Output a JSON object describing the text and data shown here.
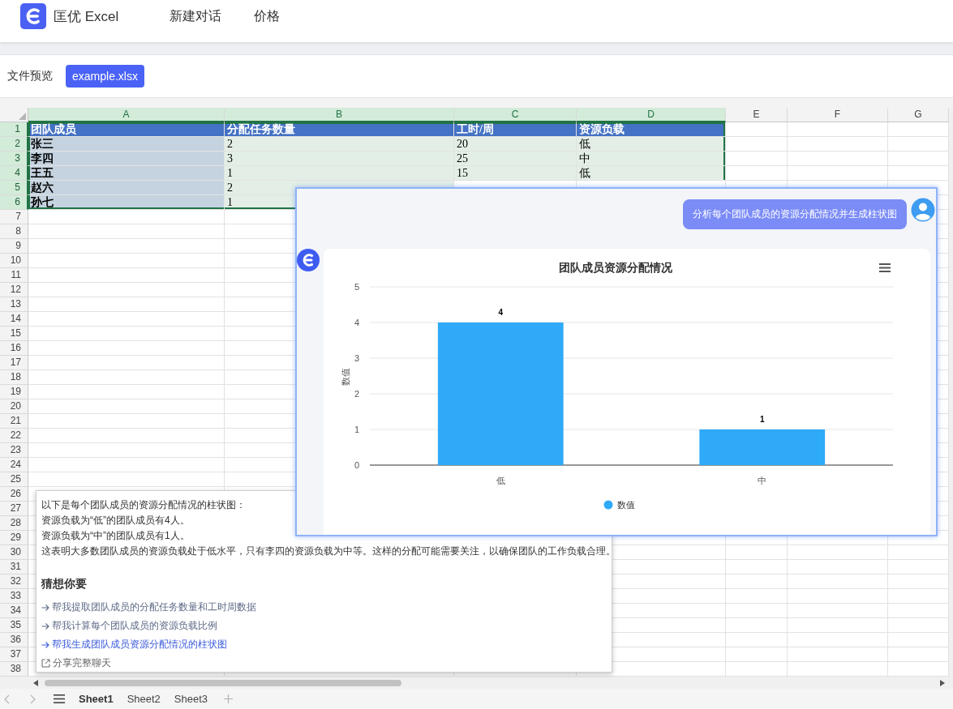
{
  "app": {
    "brand": "匡优 Excel",
    "nav": [
      "新建对话",
      "价格"
    ]
  },
  "file_preview": {
    "label": "文件预览",
    "files": [
      {
        "name": "example.xlsx",
        "selected": true
      }
    ]
  },
  "spreadsheet": {
    "columns": [
      {
        "label": "A",
        "selected": true
      },
      {
        "label": "B",
        "selected": true
      },
      {
        "label": "C",
        "selected": true
      },
      {
        "label": "D",
        "selected": true
      },
      {
        "label": "E",
        "selected": false
      },
      {
        "label": "F",
        "selected": false
      },
      {
        "label": "G",
        "selected": false
      }
    ],
    "row_numbers": [
      {
        "label": "1",
        "selected": true
      },
      {
        "label": "2",
        "selected": true
      },
      {
        "label": "3",
        "selected": true
      },
      {
        "label": "4",
        "selected": true
      },
      {
        "label": "5",
        "selected": true
      },
      {
        "label": "6",
        "selected": true
      },
      {
        "label": "7",
        "selected": false
      },
      {
        "label": "8",
        "selected": false
      },
      {
        "label": "9",
        "selected": false
      },
      {
        "label": "10",
        "selected": false
      },
      {
        "label": "11",
        "selected": false
      },
      {
        "label": "12",
        "selected": false
      },
      {
        "label": "13",
        "selected": false
      },
      {
        "label": "14",
        "selected": false
      },
      {
        "label": "15",
        "selected": false
      },
      {
        "label": "16",
        "selected": false
      },
      {
        "label": "17",
        "selected": false
      },
      {
        "label": "18",
        "selected": false
      },
      {
        "label": "19",
        "selected": false
      },
      {
        "label": "20",
        "selected": false
      },
      {
        "label": "21",
        "selected": false
      },
      {
        "label": "22",
        "selected": false
      },
      {
        "label": "23",
        "selected": false
      },
      {
        "label": "24",
        "selected": false
      },
      {
        "label": "25",
        "selected": false
      },
      {
        "label": "26",
        "selected": false
      },
      {
        "label": "27",
        "selected": false
      },
      {
        "label": "28",
        "selected": false
      },
      {
        "label": "29",
        "selected": false
      },
      {
        "label": "30",
        "selected": false
      },
      {
        "label": "31",
        "selected": false
      },
      {
        "label": "32",
        "selected": false
      },
      {
        "label": "33",
        "selected": false
      },
      {
        "label": "34",
        "selected": false
      },
      {
        "label": "35",
        "selected": false
      },
      {
        "label": "36",
        "selected": false
      },
      {
        "label": "37",
        "selected": false
      },
      {
        "label": "38",
        "selected": false
      }
    ],
    "rows": [
      {
        "kind": "header",
        "cells": [
          "团队成员",
          "分配任务数量",
          "工时/周",
          "资源负载"
        ]
      },
      {
        "kind": "data",
        "cells": [
          "张三",
          "2",
          "20",
          "低"
        ]
      },
      {
        "kind": "data",
        "cells": [
          "李四",
          "3",
          "25",
          "中"
        ]
      },
      {
        "kind": "data",
        "cells": [
          "王五",
          "1",
          "15",
          "低"
        ]
      },
      {
        "kind": "data",
        "cells": [
          "赵六",
          "2"
        ]
      },
      {
        "kind": "data",
        "cells": [
          "孙七",
          "1"
        ]
      }
    ],
    "sheet_tabs": [
      {
        "label": "Sheet1",
        "selected": true
      },
      {
        "label": "Sheet2",
        "selected": false
      },
      {
        "label": "Sheet3",
        "selected": false
      }
    ]
  },
  "chat": {
    "messages": [
      {
        "kind": "user",
        "text": "分析每个团队成员的资源分配情况并生成柱状图"
      },
      {
        "kind": "assistant",
        "chart_data": {
          "type": "bar",
          "title": "团队成员资源分配情况",
          "ylabel": "数值",
          "categories": [
            "低",
            "中"
          ],
          "series": [
            {
              "name": "数值",
              "color": "#2eaaf9",
              "values": [
                4,
                1
              ]
            }
          ],
          "ylim": [
            0,
            5
          ],
          "yticks": [
            {
              "value": 0,
              "label": "0"
            },
            {
              "value": 1,
              "label": "1"
            },
            {
              "value": 2,
              "label": "2"
            },
            {
              "value": 3,
              "label": "3"
            },
            {
              "value": 4,
              "label": "4"
            },
            {
              "value": 5,
              "label": "5"
            }
          ],
          "grid": true,
          "value_labels": [
            "4",
            "1"
          ]
        }
      }
    ]
  },
  "answer": {
    "paragraphs": [
      "以下是每个团队成员的资源分配情况的柱状图：",
      "资源负载为“低”的团队成员有4人。",
      "资源负载为“中”的团队成员有1人。",
      "这表明大多数团队成员的资源负载处于低水平，只有李四的资源负载为中等。这样的分配可能需要关注，以确保团队的工作负载合理。"
    ],
    "suggestions_title": "猜想你要",
    "suggestions": [
      {
        "text": "帮我提取团队成员的分配任务数量和工时周数据",
        "highlighted": false
      },
      {
        "text": "帮我计算每个团队成员的资源负载比例",
        "highlighted": false
      },
      {
        "text": "帮我生成团队成员资源分配情况的柱状图",
        "highlighted": true
      }
    ],
    "share": "分享完整聊天"
  }
}
